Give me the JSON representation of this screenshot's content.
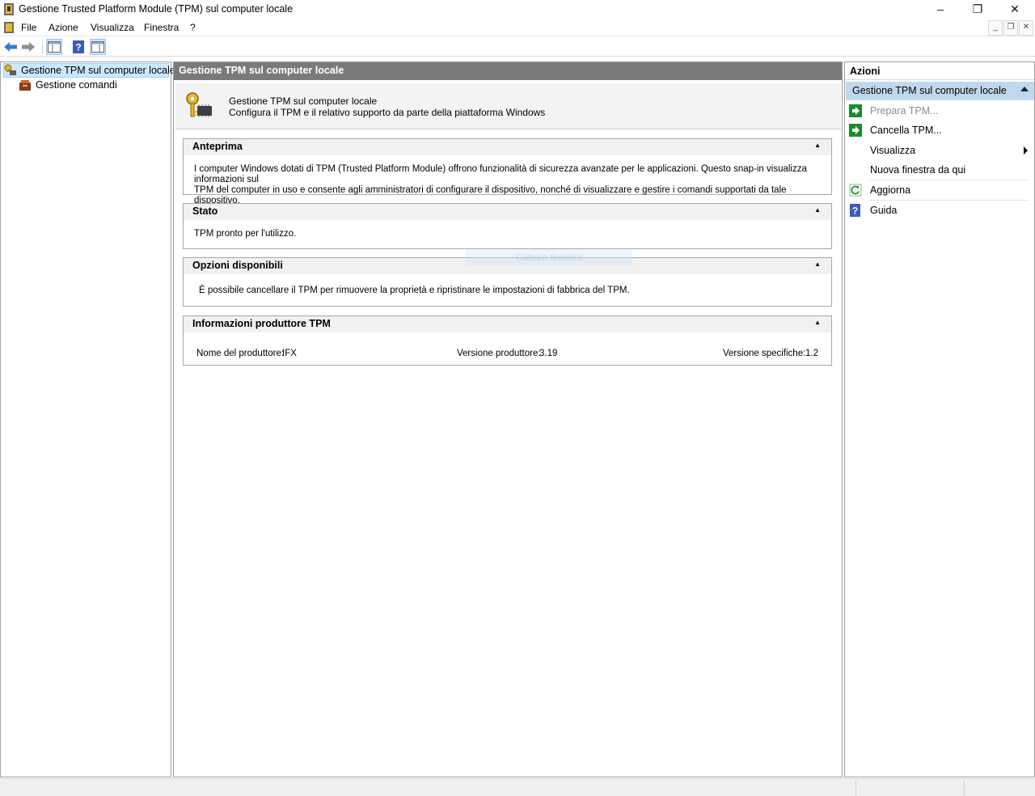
{
  "window": {
    "title": "Gestione Trusted Platform Module (TPM) sul computer locale",
    "controls": {
      "minimize": "–",
      "restore": "❐",
      "close": "✕"
    }
  },
  "menu": {
    "items": [
      "File",
      "Azione",
      "Visualizza",
      "Finestra",
      "?"
    ]
  },
  "toolbar": {
    "buttons": [
      "back-arrow-icon",
      "forward-arrow-icon",
      "show-hide-console-tree-icon",
      "help-icon",
      "show-hide-action-pane-icon"
    ]
  },
  "tree": {
    "root": "Gestione TPM sul computer locale",
    "children": [
      "Gestione comandi"
    ]
  },
  "center": {
    "header": "Gestione TPM sul computer locale",
    "banner": {
      "line1": "Gestione TPM sul computer locale",
      "line2": "Configura il TPM e il relativo supporto da parte della piattaforma Windows"
    },
    "sections": {
      "overview": {
        "title": "Anteprima",
        "body_line1": "I computer Windows dotati di TPM (Trusted Platform Module) offrono funzionalità di sicurezza avanzate per le applicazioni. Questo snap-in visualizza informazioni sul",
        "body_line2": "TPM del computer in uso e consente agli amministratori di configurare il dispositivo, nonché di visualizzare e gestire i comandi supportati da tale dispositivo."
      },
      "status": {
        "title": "Stato",
        "body": "TPM pronto per l'utilizzo."
      },
      "options": {
        "title": "Opzioni disponibili",
        "body": "È possibile cancellare il TPM per rimuovere la proprietà e ripristinare le impostazioni di fabbrica del TPM."
      },
      "manufacturer": {
        "title": "Informazioni produttore TPM",
        "name_label": "Nome del produttore:",
        "name_value": "IFX",
        "version_label": "Versione produttore:",
        "version_value": "3.19",
        "spec_label": "Versione specifiche:",
        "spec_value": "1.2"
      }
    },
    "toggle_glyph": "▲",
    "ghost_overlay": "Cattura finestra"
  },
  "actions": {
    "title": "Azioni",
    "group": "Gestione TPM sul computer locale",
    "items": {
      "prepare": "Prepara TPM...",
      "clear": "Cancella TPM...",
      "view": "Visualizza",
      "new_window": "Nuova finestra da qui",
      "refresh": "Aggiorna",
      "help": "Guida"
    }
  },
  "colors": {
    "center_header_bg": "#7a7a7a",
    "actions_group_bg": "#c0d8ee",
    "tree_selected_bg": "#cce8ff",
    "action_green": "#1e8a2e",
    "help_blue": "#3a5bb8"
  }
}
